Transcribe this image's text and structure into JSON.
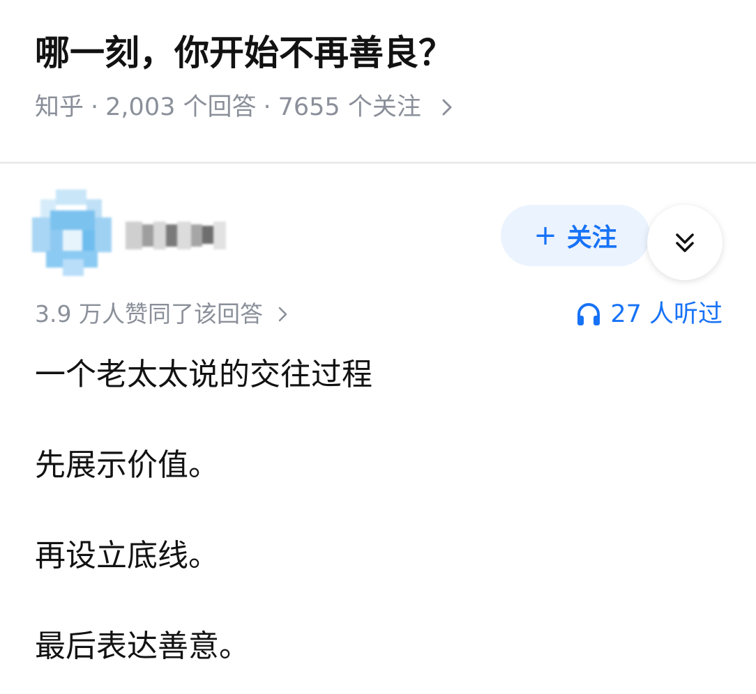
{
  "question": {
    "title": "哪一刻，你开始不再善良？",
    "source": "知乎",
    "separator": "·",
    "answers_count": "2,003 个回答",
    "followers_count": "7655 个关注",
    "chevron_icon": "chevron-right-icon"
  },
  "author": {
    "avatar_icon": "avatar-blurred",
    "name_blurred": true,
    "follow_label": "关注",
    "follow_plus": "+",
    "more_icon": "double-chevron-down-icon"
  },
  "stats": {
    "votes_text": "3.9 万人赞同了该回答",
    "listen_text": "27 人听过",
    "listen_icon": "headphones-icon"
  },
  "answer": {
    "paragraphs": [
      "一个老太太说的交往过程",
      "先展示价值。",
      "再设立底线。",
      "最后表达善意。"
    ]
  },
  "colors": {
    "accent": "#1772f6",
    "follow_bg": "#ebf3fe",
    "meta_gray": "#8a8f99",
    "text": "#121212",
    "divider": "#ebebeb"
  }
}
